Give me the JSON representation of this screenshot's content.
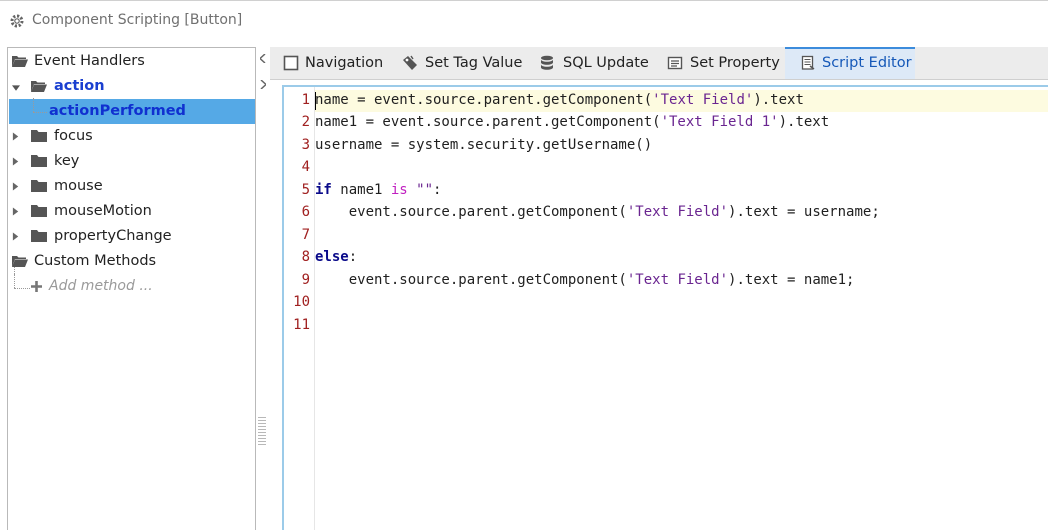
{
  "window": {
    "title": "Component Scripting [Button]",
    "title_icon": "gear-icon"
  },
  "tree": {
    "items": [
      {
        "label": "Event Handlers",
        "icon": "folder-open-icon"
      },
      {
        "label": "action",
        "icon": "folder-open-icon"
      },
      {
        "label": "actionPerformed",
        "selected": true
      },
      {
        "label": "focus",
        "icon": "folder-icon"
      },
      {
        "label": "key",
        "icon": "folder-icon"
      },
      {
        "label": "mouse",
        "icon": "folder-icon"
      },
      {
        "label": "mouseMotion",
        "icon": "folder-icon"
      },
      {
        "label": "propertyChange",
        "icon": "folder-icon"
      },
      {
        "label": "Custom Methods",
        "icon": "folder-open-icon"
      },
      {
        "label": "Add method ...",
        "icon": "plus-icon"
      }
    ]
  },
  "tabs": [
    {
      "label": "Navigation",
      "icon": "checkbox-icon"
    },
    {
      "label": "Set Tag Value",
      "icon": "tag-icon"
    },
    {
      "label": "SQL Update",
      "icon": "database-icon"
    },
    {
      "label": "Set Property",
      "icon": "property-icon"
    },
    {
      "label": "Script Editor",
      "icon": "script-icon",
      "active": true
    }
  ],
  "editor": {
    "line_numbers": [
      "1",
      "2",
      "3",
      "4",
      "5",
      "6",
      "7",
      "8",
      "9",
      "10",
      "11"
    ],
    "lines": {
      "l1": {
        "a": "name = event.source.parent.getComponent(",
        "s": "'Text Field'",
        "b": ").text"
      },
      "l2": {
        "a": "name1 = event.source.parent.getComponent(",
        "s": "'Text Field 1'",
        "b": ").text"
      },
      "l3": {
        "a": "username = system.security.getUsername()"
      },
      "l5": {
        "kw": "if",
        "a": " name1 ",
        "op": "is",
        "sp": " ",
        "s": "\"\"",
        "b": ":"
      },
      "l6": {
        "a": "    event.source.parent.getComponent(",
        "s": "'Text Field'",
        "b": ").text = username;"
      },
      "l8": {
        "kw": "else",
        "b": ":"
      },
      "l9": {
        "a": "    event.source.parent.getComponent(",
        "s": "'Text Field'",
        "b": ").text = name1;"
      }
    }
  },
  "colors": {
    "selection": "#55a9e6",
    "active_tab": "#dde9f7",
    "accent": "#3c8cdc",
    "string": "#6a2590",
    "keyword": "#0a0a8a",
    "line_number": "#a02020"
  }
}
